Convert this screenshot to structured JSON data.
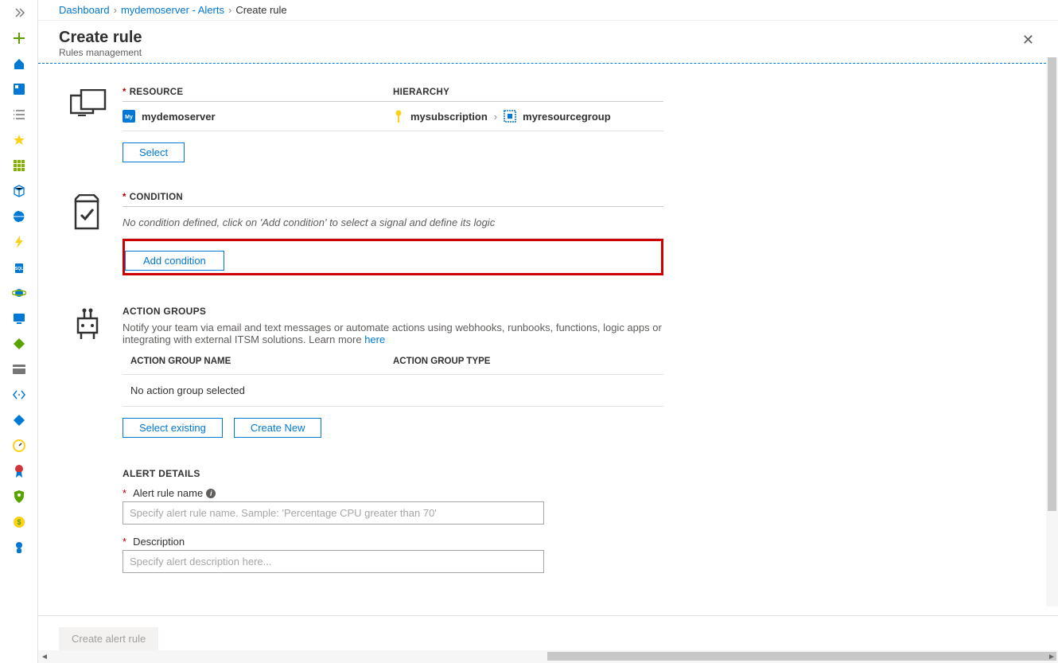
{
  "breadcrumb": {
    "dashboard": "Dashboard",
    "alerts": "mydemoserver - Alerts",
    "create": "Create rule"
  },
  "header": {
    "title": "Create rule",
    "subtitle": "Rules management"
  },
  "resource": {
    "label": "RESOURCE",
    "hierarchy_label": "HIERARCHY",
    "server": "mydemoserver",
    "subscription": "mysubscription",
    "group": "myresourcegroup",
    "select_btn": "Select"
  },
  "condition": {
    "label": "CONDITION",
    "hint": "No condition defined, click on 'Add condition' to select a signal and define its logic",
    "add_btn": "Add condition"
  },
  "action_groups": {
    "title": "ACTION GROUPS",
    "desc": "Notify your team via email and text messages or automate actions using webhooks, runbooks, functions, logic apps or integrating with external ITSM solutions. Learn more ",
    "learn_more": "here",
    "col_name": "ACTION GROUP NAME",
    "col_type": "ACTION GROUP TYPE",
    "empty": "No action group selected",
    "select_existing": "Select existing",
    "create_new": "Create New"
  },
  "alert_details": {
    "title": "ALERT DETAILS",
    "name_label": "Alert rule name",
    "name_placeholder": "Specify alert rule name. Sample: 'Percentage CPU greater than 70'",
    "desc_label": "Description",
    "desc_placeholder": "Specify alert description here..."
  },
  "footer": {
    "create_btn": "Create alert rule"
  }
}
